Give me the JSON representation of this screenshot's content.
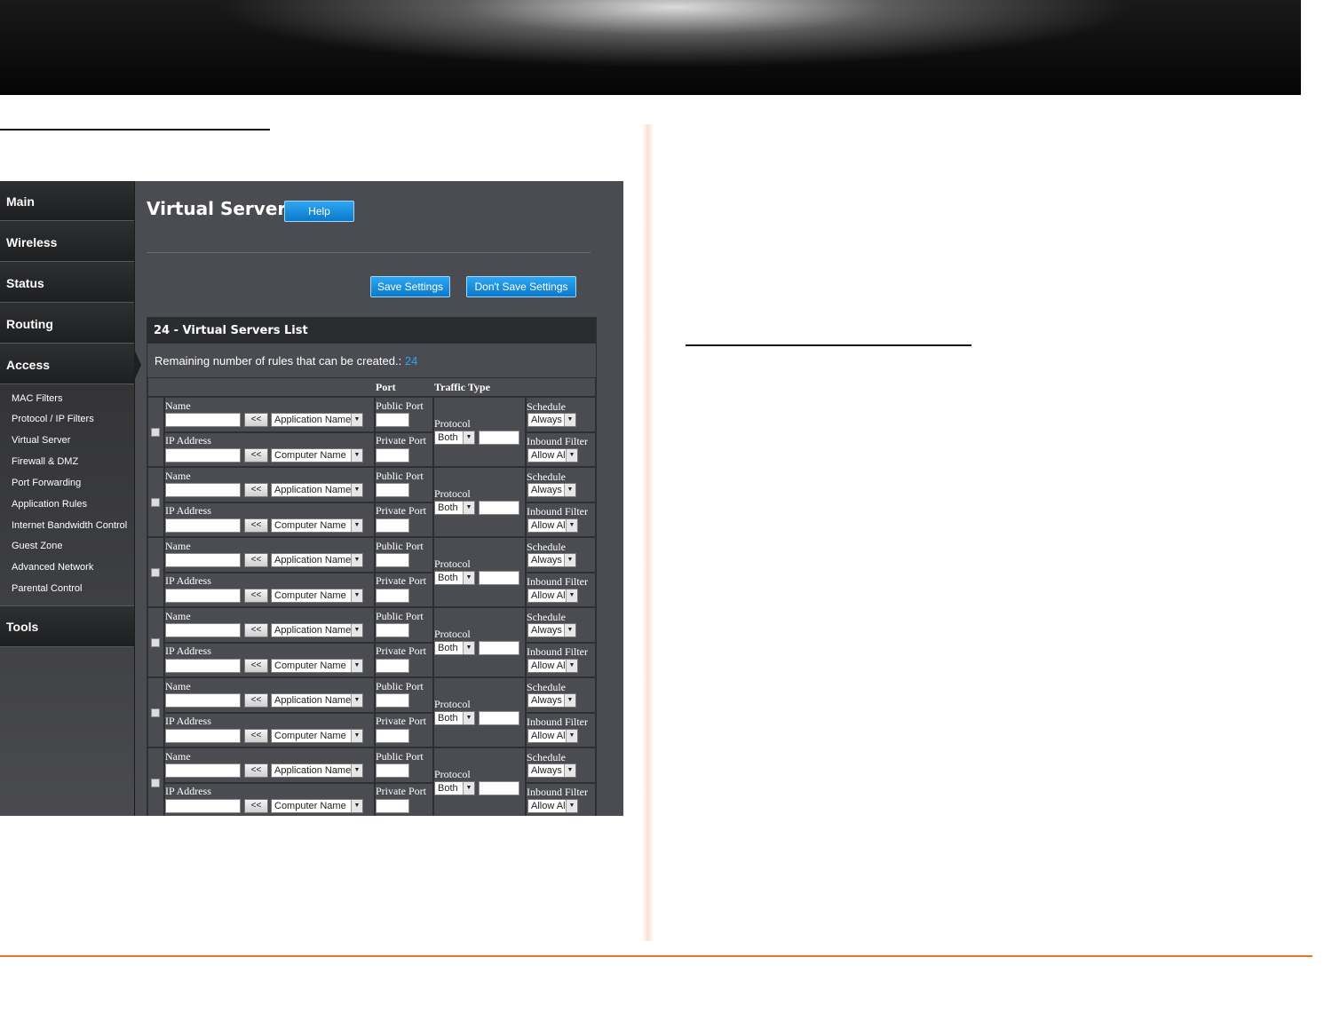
{
  "router": {
    "page_title": "Virtual Server",
    "help_label": "Help",
    "save_label": "Save Settings",
    "dont_save_label": "Don't Save Settings",
    "nav": {
      "main": "Main",
      "wireless": "Wireless",
      "status": "Status",
      "routing": "Routing",
      "access": "Access",
      "tools": "Tools"
    },
    "access_items": [
      "MAC Filters",
      "Protocol / IP Filters",
      "Virtual Server",
      "Firewall & DMZ",
      "Port Forwarding",
      "Application Rules",
      "Internet Bandwidth Control",
      "Guest Zone",
      "Advanced Network",
      "Parental Control"
    ],
    "list": {
      "title": "24 - Virtual Servers List",
      "remaining_label": "Remaining number of rules that can be created.:",
      "remaining_value": "24",
      "col_port": "Port",
      "col_traffic": "Traffic Type"
    },
    "labels": {
      "name": "Name",
      "ip_address": "IP Address",
      "public_port": "Public Port",
      "private_port": "Private Port",
      "protocol": "Protocol",
      "schedule": "Schedule",
      "inbound_filter": "Inbound Filter",
      "copy_button": "<<",
      "app_name_select": "Application Name",
      "computer_name_select": "Computer Name",
      "protocol_select": "Both",
      "schedule_select": "Always",
      "inbound_select": "Allow All"
    }
  }
}
